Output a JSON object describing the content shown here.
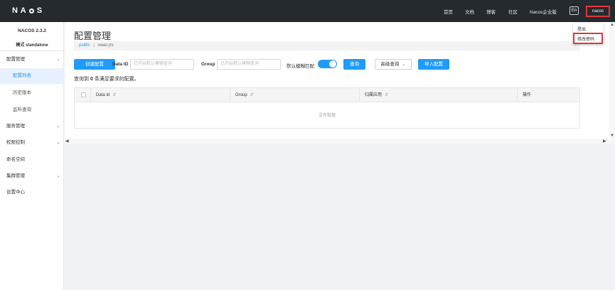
{
  "header": {
    "logo": "NACOS",
    "nav": [
      "首页",
      "文档",
      "博客",
      "社区",
      "Nacos企业版"
    ],
    "lang": "En",
    "user": "nacos",
    "user_menu": [
      "登出",
      "修改密码"
    ]
  },
  "sidebar": {
    "version": "NACOS 2.3.2",
    "mode": "模式 standalone",
    "items": [
      {
        "label": "配置管理",
        "expandable": true
      },
      {
        "label": "配置列表",
        "active": true
      },
      {
        "label": "历史版本"
      },
      {
        "label": "监听查询"
      },
      {
        "label": "服务管理",
        "expandable": true
      },
      {
        "label": "权限控制",
        "expandable": true
      },
      {
        "label": "命名空间"
      },
      {
        "label": "集群管理",
        "expandable": true
      },
      {
        "label": "设置中心"
      }
    ]
  },
  "main": {
    "title": "配置管理",
    "breadcrumb": {
      "namespace": "public",
      "separator": "|",
      "current": "vwac-jrs"
    },
    "toolbar": {
      "create_label": "创建配置",
      "dataid_label": "Data ID",
      "dataid_placeholder": "已开启默认模糊查询",
      "group_label": "Group",
      "group_placeholder": "已开启默认模糊查询",
      "fuzzy_label": "默认模糊匹配",
      "fuzzy_enabled": true,
      "query_label": "查询",
      "advanced_label": "高级查询",
      "import_label": "导入配置"
    },
    "result": {
      "prefix": "查询到",
      "count": "0",
      "suffix": "条满足要求的配置。"
    },
    "table": {
      "columns": [
        "Data Id",
        "Group",
        "归属应用",
        "操作"
      ],
      "empty_text": "没有数据"
    }
  },
  "colors": {
    "accent": "#209bfa",
    "topbar": "#252a2f",
    "highlight": "#e0373c"
  }
}
